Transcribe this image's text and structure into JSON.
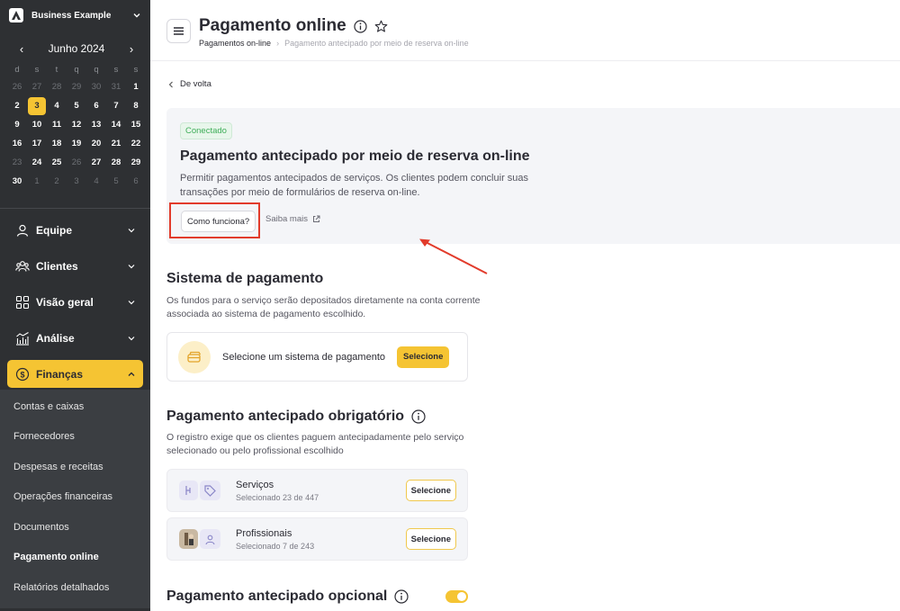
{
  "sidebar": {
    "business_name": "Business Example",
    "calendar": {
      "month_label": "Junho 2024",
      "prev": "‹",
      "next": "›",
      "weekdays": [
        "d",
        "s",
        "t",
        "q",
        "q",
        "s",
        "s"
      ],
      "days": [
        {
          "d": "26",
          "m": true
        },
        {
          "d": "27",
          "m": true
        },
        {
          "d": "28",
          "m": true
        },
        {
          "d": "29",
          "m": true
        },
        {
          "d": "30",
          "m": true
        },
        {
          "d": "31",
          "m": true
        },
        {
          "d": "1"
        },
        {
          "d": "2"
        },
        {
          "d": "3",
          "t": true
        },
        {
          "d": "4"
        },
        {
          "d": "5"
        },
        {
          "d": "6"
        },
        {
          "d": "7"
        },
        {
          "d": "8"
        },
        {
          "d": "9"
        },
        {
          "d": "10"
        },
        {
          "d": "11"
        },
        {
          "d": "12"
        },
        {
          "d": "13"
        },
        {
          "d": "14"
        },
        {
          "d": "15"
        },
        {
          "d": "16"
        },
        {
          "d": "17"
        },
        {
          "d": "18"
        },
        {
          "d": "19"
        },
        {
          "d": "20"
        },
        {
          "d": "21"
        },
        {
          "d": "22"
        },
        {
          "d": "23",
          "m": true
        },
        {
          "d": "24"
        },
        {
          "d": "25"
        },
        {
          "d": "26",
          "m": true
        },
        {
          "d": "27"
        },
        {
          "d": "28"
        },
        {
          "d": "29"
        },
        {
          "d": "30"
        },
        {
          "d": "1",
          "m": true
        },
        {
          "d": "2",
          "m": true
        },
        {
          "d": "3",
          "m": true
        },
        {
          "d": "4",
          "m": true
        },
        {
          "d": "5",
          "m": true
        },
        {
          "d": "6",
          "m": true
        }
      ]
    },
    "nav": {
      "equipe": "Equipe",
      "clientes": "Clientes",
      "visao": "Visão geral",
      "analise": "Análise",
      "financas": "Finanças"
    },
    "sub": {
      "contas": "Contas e caixas",
      "fornecedores": "Fornecedores",
      "despesas": "Despesas e receitas",
      "operacoes": "Operações financeiras",
      "documentos": "Documentos",
      "pagamento": "Pagamento online",
      "relatorios": "Relatórios detalhados"
    }
  },
  "header": {
    "title": "Pagamento online",
    "crumb_1": "Pagamentos on-line",
    "crumb_sep": "›",
    "crumb_2": "Pagamento antecipado por meio de reserva on-line"
  },
  "back_label": "De volta",
  "card": {
    "badge": "Conectado",
    "title": "Pagamento antecipado por meio de reserva on-line",
    "desc": "Permitir pagamentos antecipados de serviços. Os clientes podem concluir suas transações por meio de formulários de reserva on-line.",
    "how_label": "Como funciona?",
    "more_label": "Saiba mais"
  },
  "payment_system": {
    "title": "Sistema de pagamento",
    "desc": "Os fundos para o serviço serão depositados diretamente na conta corrente associada ao sistema de pagamento escolhido.",
    "box_label": "Selecione um sistema de pagamento",
    "button": "Selecione"
  },
  "mandatory": {
    "title": "Pagamento antecipado obrigatório",
    "desc": "O registro exige que os clientes paguem antecipadamente pelo serviço selecionado ou pelo profissional escolhido",
    "services": {
      "name": "Serviços",
      "count": "Selecionado 23 de 447",
      "button": "Selecione"
    },
    "pros": {
      "name": "Profissionais",
      "count": "Selecionado 7 de 243",
      "button": "Selecione"
    }
  },
  "optional": {
    "title": "Pagamento antecipado opcional",
    "enabled": true
  },
  "colors": {
    "accent": "#f5c433",
    "sidebar": "#2e3033",
    "annotation": "#e23b2b",
    "connected": "#3fae5a"
  }
}
